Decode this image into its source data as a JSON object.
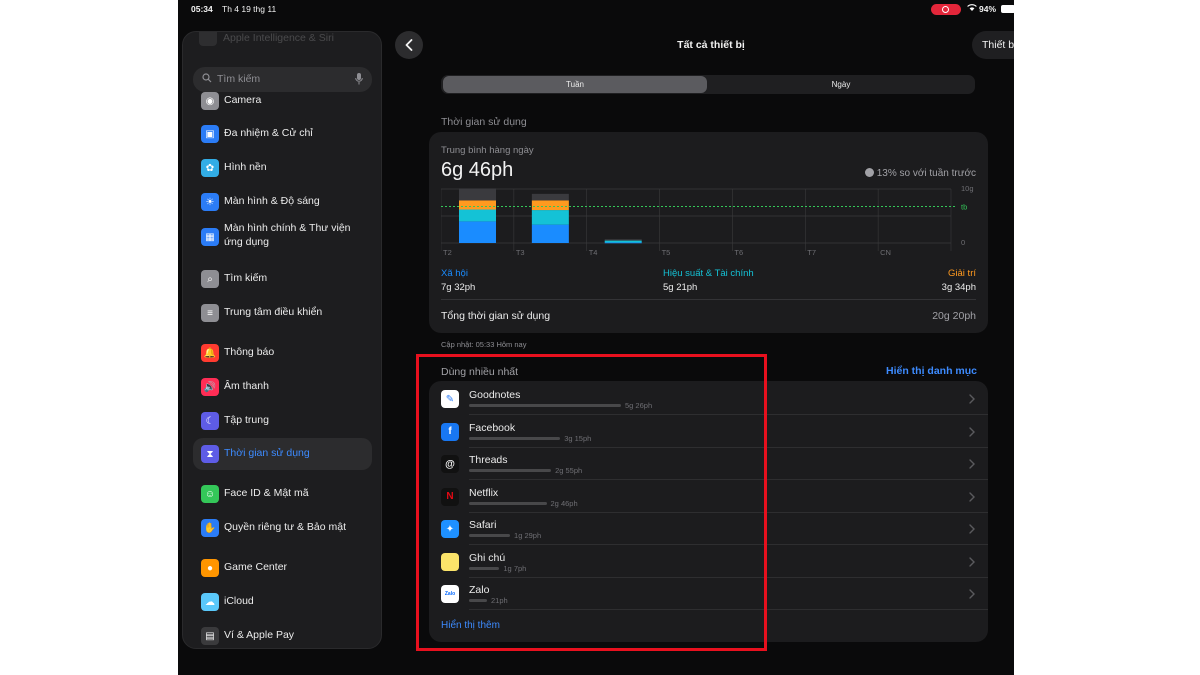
{
  "status_bar": {
    "time": "05:34",
    "date": "Th 4 19 thg 11",
    "battery": "94%"
  },
  "sidebar": {
    "ghost_item": "Apple Intelligence & Siri",
    "search_placeholder": "Tìm kiếm",
    "items": [
      {
        "label": "Camera",
        "icon": "camera-icon",
        "color": "#8e8e93"
      },
      {
        "label": "Đa nhiệm & Cử chỉ",
        "icon": "multitasking-icon",
        "color": "#2b7cf6"
      },
      {
        "label": "Hình nền",
        "icon": "wallpaper-icon",
        "color": "#32ade6"
      },
      {
        "label": "Màn hình & Độ sáng",
        "icon": "brightness-icon",
        "color": "#2b7cf6"
      },
      {
        "label": "Màn hình chính & Thư viện ứng dụng",
        "icon": "home-screen-icon",
        "color": "#2b7cf6"
      },
      {
        "label": "Tìm kiếm",
        "icon": "search-icon",
        "color": "#8e8e93"
      },
      {
        "label": "Trung tâm điều khiển",
        "icon": "control-center-icon",
        "color": "#8e8e93"
      },
      {
        "label": "Thông báo",
        "icon": "notifications-icon",
        "color": "#ff3b30"
      },
      {
        "label": "Âm thanh",
        "icon": "sound-icon",
        "color": "#ff2d55"
      },
      {
        "label": "Tập trung",
        "icon": "focus-icon",
        "color": "#5e5ce6"
      },
      {
        "label": "Thời gian sử dụng",
        "icon": "screen-time-icon",
        "color": "#5e5ce6",
        "active": true
      },
      {
        "label": "Face ID & Mật mã",
        "icon": "face-id-icon",
        "color": "#34c759"
      },
      {
        "label": "Quyền riêng tư & Bảo mật",
        "icon": "privacy-icon",
        "color": "#2b7cf6"
      },
      {
        "label": "Game Center",
        "icon": "game-center-icon",
        "color": "#ff9500"
      },
      {
        "label": "iCloud",
        "icon": "icloud-icon",
        "color": "#5ac8fa"
      },
      {
        "label": "Ví & Apple Pay",
        "icon": "wallet-icon",
        "color": "#3a3a3c"
      }
    ]
  },
  "header": {
    "title": "Tất cả thiết bị",
    "right_button": "Thiết b"
  },
  "segmented": {
    "options": [
      "Tuần",
      "Ngày"
    ],
    "selected": "Tuần"
  },
  "usage": {
    "section_label": "Thời gian sử dụng",
    "avg_label": "Trung bình hàng ngày",
    "avg_value": "6g 46ph",
    "comparison": "13% so với tuần trước",
    "categories": [
      {
        "name": "Xã hội",
        "value": "7g 32ph",
        "color": "#1a8cff"
      },
      {
        "name": "Hiệu suất & Tài chính",
        "value": "5g 21ph",
        "color": "#14c2d6"
      },
      {
        "name": "Giải trí",
        "value": "3g 34ph",
        "color": "#ff9a1f"
      }
    ],
    "total_label": "Tổng thời gian sử dụng",
    "total_value": "20g 20ph",
    "update": "Cập nhật: 05:33 Hôm nay"
  },
  "chart_data": {
    "type": "bar",
    "stacked": true,
    "categories": [
      "T2",
      "T3",
      "T4",
      "T5",
      "T6",
      "T7",
      "CN"
    ],
    "series": [
      {
        "name": "Xã hội",
        "values": [
          4.0,
          3.4,
          0.1,
          0,
          0,
          0,
          0
        ],
        "color": "#1a8cff"
      },
      {
        "name": "Hiệu suất & Tài chính",
        "values": [
          2.2,
          2.7,
          0.35,
          0,
          0,
          0,
          0
        ],
        "color": "#14c2d6"
      },
      {
        "name": "Giải trí",
        "values": [
          1.7,
          1.8,
          0,
          0,
          0,
          0,
          0
        ],
        "color": "#ff9a1f"
      },
      {
        "name": "Khác",
        "values": [
          2.2,
          1.2,
          0.25,
          0,
          0,
          0,
          0
        ],
        "color": "#3a3a3e"
      }
    ],
    "y_ticks": [
      "10g",
      "tb",
      "0"
    ],
    "average_line": 6.77,
    "ylim": [
      0,
      10
    ]
  },
  "most_used": {
    "title": "Dùng nhiều nhất",
    "show_categories": "Hiển thị danh mục",
    "show_more": "Hiển thị thêm",
    "apps": [
      {
        "name": "Goodnotes",
        "time": "5g 26ph",
        "fraction": 1.0,
        "icon": "goodnotes-icon",
        "color": "#ffffff",
        "glyph": "✎"
      },
      {
        "name": "Facebook",
        "time": "3g 15ph",
        "fraction": 0.6,
        "icon": "facebook-icon",
        "color": "#1877f2",
        "glyph": "f"
      },
      {
        "name": "Threads",
        "time": "2g 55ph",
        "fraction": 0.54,
        "icon": "threads-icon",
        "color": "#111111",
        "glyph": "@"
      },
      {
        "name": "Netflix",
        "time": "2g 46ph",
        "fraction": 0.51,
        "icon": "netflix-icon",
        "color": "#111111",
        "glyph": "N"
      },
      {
        "name": "Safari",
        "time": "1g 29ph",
        "fraction": 0.27,
        "icon": "safari-icon",
        "color": "#1e90ff",
        "glyph": "✦"
      },
      {
        "name": "Ghi chú",
        "time": "1g 7ph",
        "fraction": 0.2,
        "icon": "notes-icon",
        "color": "#fbe46a",
        "glyph": ""
      },
      {
        "name": "Zalo",
        "time": "21ph",
        "fraction": 0.06,
        "icon": "zalo-icon",
        "color": "#0a6cff",
        "glyph": "Zalo"
      }
    ]
  }
}
